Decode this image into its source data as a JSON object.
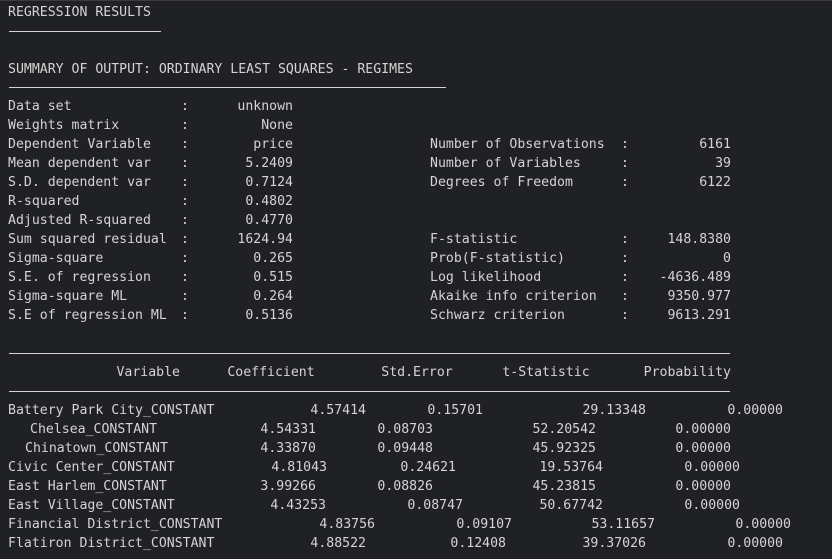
{
  "title": "REGRESSION RESULTS",
  "summary_heading": "SUMMARY OF OUTPUT: ORDINARY LEAST SQUARES - REGIMES",
  "left_stats": [
    {
      "label": "Data set",
      "sep": ":",
      "value": "unknown"
    },
    {
      "label": "Weights matrix",
      "sep": ":",
      "value": "None"
    },
    {
      "label": "Dependent Variable",
      "sep": ":",
      "value": "price"
    },
    {
      "label": "Mean dependent var",
      "sep": ":",
      "value": "5.2409"
    },
    {
      "label": "S.D. dependent var",
      "sep": ":",
      "value": "0.7124"
    },
    {
      "label": "R-squared",
      "sep": ":",
      "value": "0.4802"
    },
    {
      "label": "Adjusted R-squared",
      "sep": ":",
      "value": "0.4770"
    },
    {
      "label": "Sum squared residual",
      "sep": ":",
      "value": "1624.94"
    },
    {
      "label": "Sigma-square",
      "sep": ":",
      "value": "0.265"
    },
    {
      "label": "S.E. of regression",
      "sep": ":",
      "value": "0.515"
    },
    {
      "label": "Sigma-square ML",
      "sep": ":",
      "value": "0.264"
    },
    {
      "label": "S.E of regression ML",
      "sep": ":",
      "value": "0.5136"
    }
  ],
  "right_stats": [
    {
      "label": "Number of Observations",
      "sep": ":",
      "value": "6161"
    },
    {
      "label": "Number of Variables",
      "sep": ":",
      "value": "39"
    },
    {
      "label": "Degrees of Freedom",
      "sep": ":",
      "value": "6122"
    },
    {
      "label": "F-statistic",
      "sep": ":",
      "value": "148.8380"
    },
    {
      "label": "Prob(F-statistic)",
      "sep": ":",
      "value": "0"
    },
    {
      "label": "Log likelihood",
      "sep": ":",
      "value": "-4636.489"
    },
    {
      "label": "Akaike info criterion",
      "sep": ":",
      "value": "9350.977"
    },
    {
      "label": "Schwarz criterion",
      "sep": ":",
      "value": "9613.291"
    }
  ],
  "table": {
    "headers": [
      "Variable",
      "Coefficient",
      "Std.Error",
      "t-Statistic",
      "Probability"
    ],
    "rows": [
      {
        "variable": "Battery Park City_CONSTANT",
        "coef": "4.57414",
        "se": "0.15701",
        "t": "29.13348",
        "p": "0.00000"
      },
      {
        "variable": "Chelsea_CONSTANT",
        "coef": "4.54331",
        "se": "0.08703",
        "t": "52.20542",
        "p": "0.00000"
      },
      {
        "variable": "Chinatown_CONSTANT",
        "coef": "4.33870",
        "se": "0.09448",
        "t": "45.92325",
        "p": "0.00000"
      },
      {
        "variable": "Civic Center_CONSTANT",
        "coef": "4.81043",
        "se": "0.24621",
        "t": "19.53764",
        "p": "0.00000"
      },
      {
        "variable": "East Harlem_CONSTANT",
        "coef": "3.99266",
        "se": "0.08826",
        "t": "45.23815",
        "p": "0.00000"
      },
      {
        "variable": "East Village_CONSTANT",
        "coef": "4.43253",
        "se": "0.08747",
        "t": "50.67742",
        "p": "0.00000"
      },
      {
        "variable": "Financial District_CONSTANT",
        "coef": "4.83756",
        "se": "0.09107",
        "t": "53.11657",
        "p": "0.00000"
      },
      {
        "variable": "Flatiron District_CONSTANT",
        "coef": "4.88522",
        "se": "0.12408",
        "t": "39.37026",
        "p": "0.00000"
      }
    ]
  }
}
